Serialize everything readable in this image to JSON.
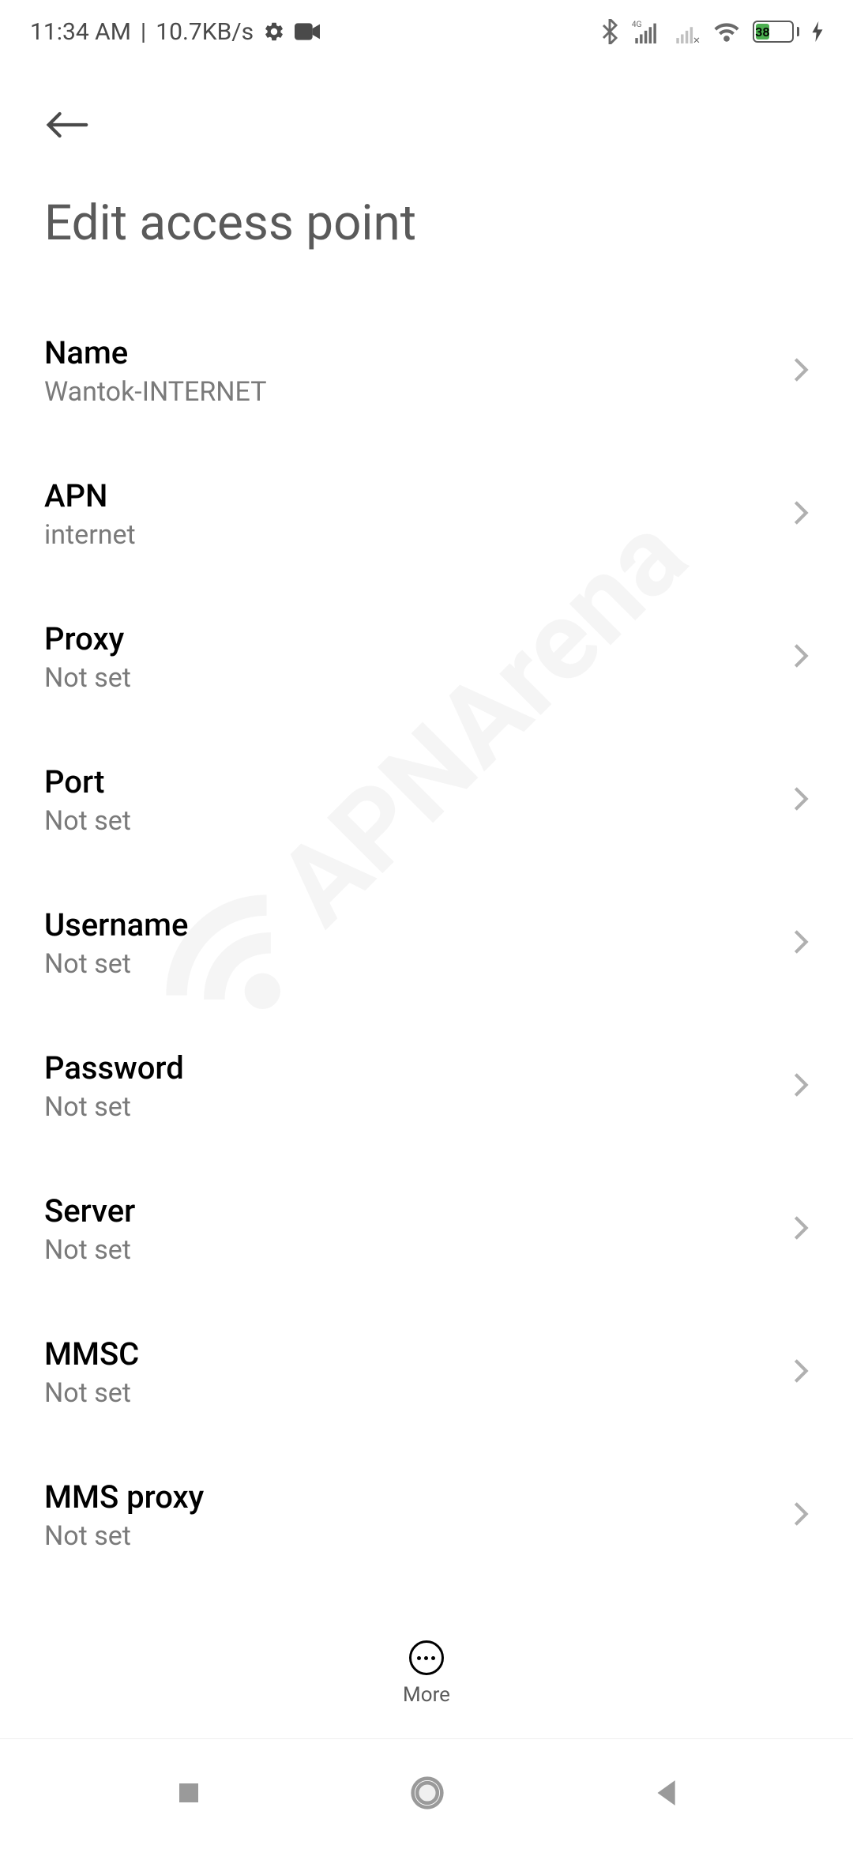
{
  "status_bar": {
    "time": "11:34 AM",
    "separator": "|",
    "data_rate": "10.7KB/s",
    "battery_percent": "38"
  },
  "page": {
    "title": "Edit access point"
  },
  "settings": [
    {
      "label": "Name",
      "value": "Wantok-INTERNET"
    },
    {
      "label": "APN",
      "value": "internet"
    },
    {
      "label": "Proxy",
      "value": "Not set"
    },
    {
      "label": "Port",
      "value": "Not set"
    },
    {
      "label": "Username",
      "value": "Not set"
    },
    {
      "label": "Password",
      "value": "Not set"
    },
    {
      "label": "Server",
      "value": "Not set"
    },
    {
      "label": "MMSC",
      "value": "Not set"
    },
    {
      "label": "MMS proxy",
      "value": "Not set"
    }
  ],
  "toolbar": {
    "more_label": "More"
  },
  "watermark": {
    "text": "APNArena"
  }
}
